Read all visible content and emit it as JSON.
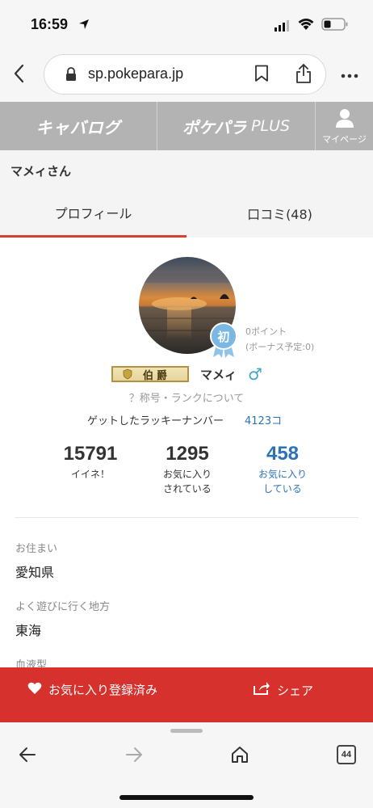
{
  "status_bar": {
    "time": "16:59"
  },
  "browser": {
    "url": "sp.pokepara.jp",
    "tab_count": "44"
  },
  "nav": {
    "logo_left": "キャバログ",
    "logo_right": "ポケパラ",
    "logo_right_suffix": "PLUS",
    "mypage_label": "マイページ"
  },
  "profile_header": {
    "name": "マメィさん"
  },
  "tabs": [
    {
      "label": "プロフィール",
      "active": true
    },
    {
      "label": "口コミ(48)",
      "active": false
    }
  ],
  "profile": {
    "badge": "初",
    "points_line1": "0ポイント",
    "points_line2": "(ボーナス予定:0)",
    "rank": "伯爵",
    "username": "マメィ",
    "gender_symbol": "♂",
    "title_link": "？称号・ランクについて",
    "lucky_label": "ゲットしたラッキーナンバー",
    "lucky_value": "4123コ"
  },
  "stats": [
    {
      "value": "15791",
      "label_line1": "イイネ！",
      "label_line2": ""
    },
    {
      "value": "1295",
      "label_line1": "お気に入り",
      "label_line2": "されている"
    },
    {
      "value": "458",
      "label_line1": "お気に入り",
      "label_line2": "している"
    }
  ],
  "details": [
    {
      "label": "お住まい",
      "value": "愛知県"
    },
    {
      "label": "よく遊びに行く地方",
      "value": "東海"
    },
    {
      "label": "血液型",
      "value": ""
    }
  ],
  "actions": {
    "favorite_label": "お気に入り登録済み",
    "share_label": "シェア"
  },
  "colors": {
    "accent_red": "#d6312c",
    "link_blue": "#2b72b8",
    "nav_gray": "#b3b3b3"
  }
}
